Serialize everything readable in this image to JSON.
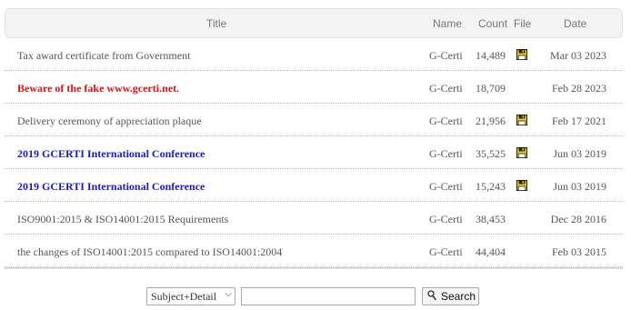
{
  "table": {
    "headers": {
      "title": "Title",
      "name": "Name",
      "count": "Count",
      "file": "File",
      "date": "Date"
    },
    "rows": [
      {
        "title": "Tax award certificate from Government",
        "name": "G-Certi",
        "count": "14,489",
        "has_file": true,
        "date": "Mar 03 2023",
        "style": "normal"
      },
      {
        "title": "Beware of the fake www.gcerti.net.",
        "name": "G-Certi",
        "count": "18,709",
        "has_file": false,
        "date": "Feb 28 2023",
        "style": "red"
      },
      {
        "title": "Delivery ceremony of appreciation plaque",
        "name": "G-Certi",
        "count": "21,956",
        "has_file": true,
        "date": "Feb 17 2021",
        "style": "normal"
      },
      {
        "title": "2019 GCERTI International Conference",
        "name": "G-Certi",
        "count": "35,525",
        "has_file": true,
        "date": "Jun 03 2019",
        "style": "blue"
      },
      {
        "title": "2019 GCERTI International Conference",
        "name": "G-Certi",
        "count": "15,243",
        "has_file": true,
        "date": "Jun 03 2019",
        "style": "blue"
      },
      {
        "title": "ISO9001:2015 & ISO14001:2015 Requirements",
        "name": "G-Certi",
        "count": "38,453",
        "has_file": false,
        "date": "Dec 28 2016",
        "style": "normal"
      },
      {
        "title": "the changes of ISO14001:2015 compared to ISO14001:2004",
        "name": "G-Certi",
        "count": "44,404",
        "has_file": false,
        "date": "Feb 03 2015",
        "style": "normal"
      }
    ]
  },
  "search": {
    "scope_selected": "Subject+Detail",
    "query_value": "",
    "button_label": "Search",
    "button_icon": "magnifier-icon"
  },
  "colors": {
    "red_title": "#e01010",
    "blue_title": "#1a1acc",
    "header_bg": "#f3f3f3"
  }
}
